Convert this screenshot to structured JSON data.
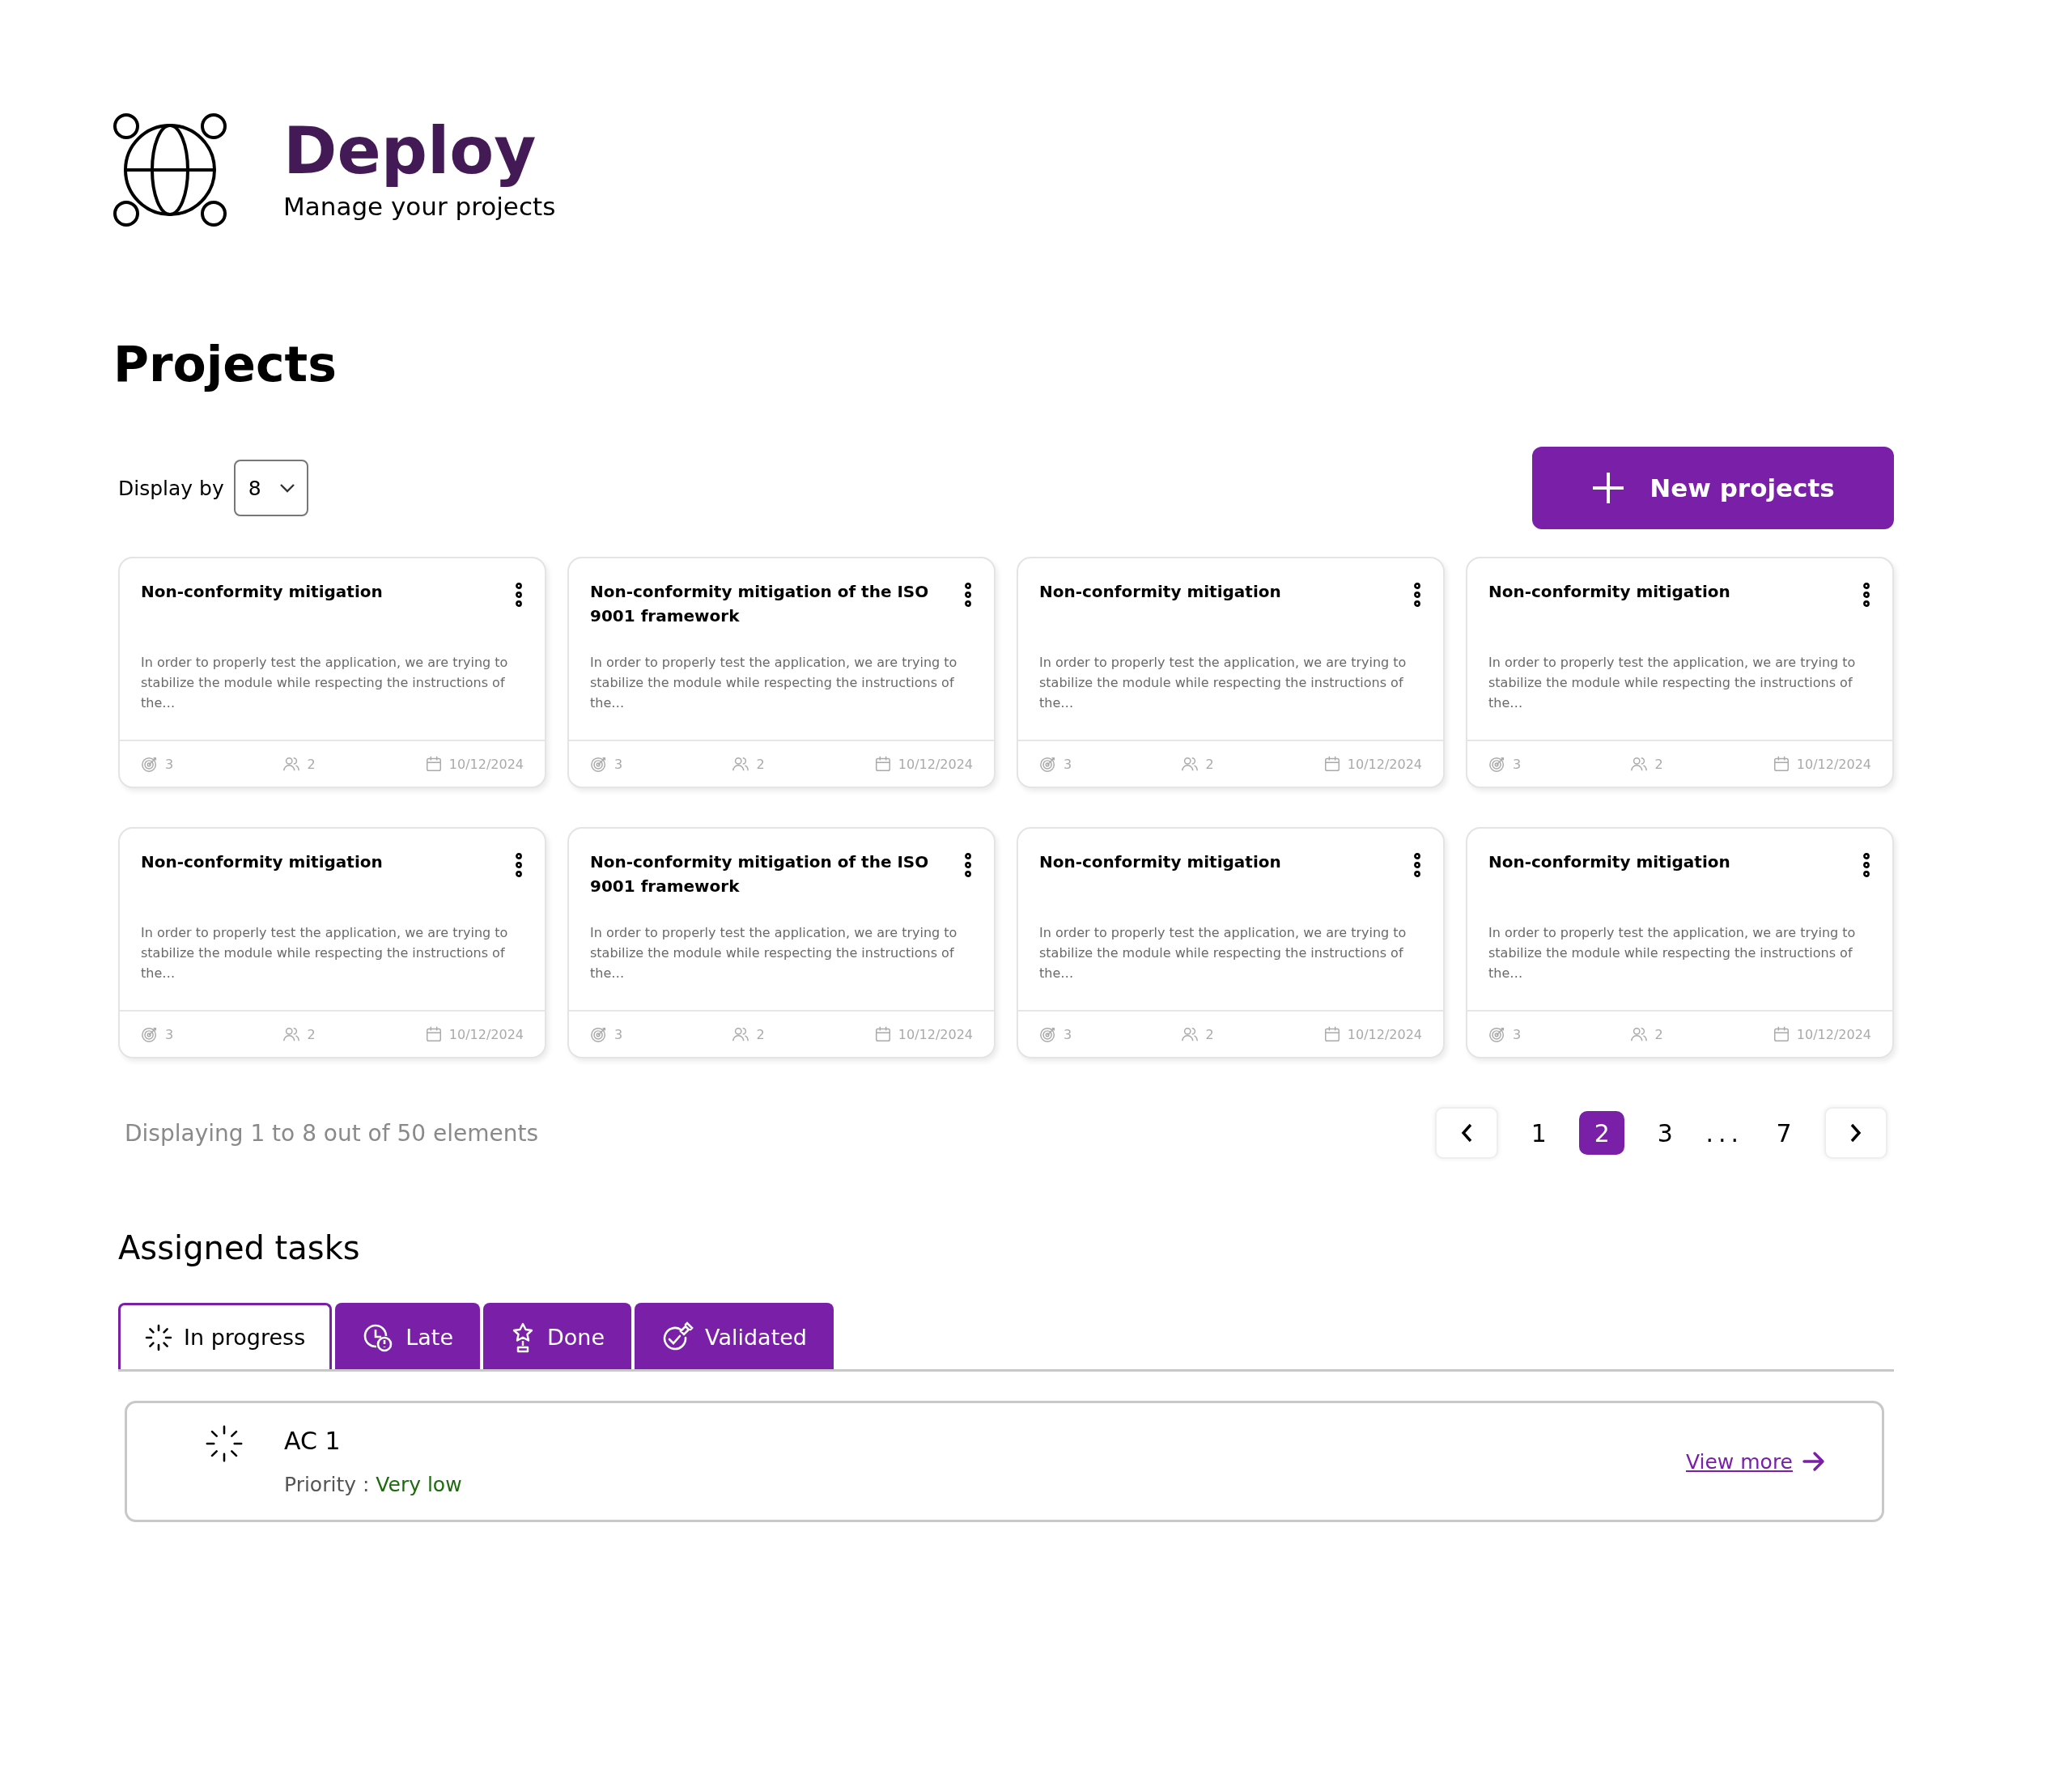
{
  "header": {
    "title": "Deploy",
    "subtitle": "Manage your projects"
  },
  "projects": {
    "heading": "Projects",
    "display_by": {
      "label": "Display by",
      "value": "8"
    },
    "new_button": "New projects",
    "cards": [
      {
        "title": "Non-conformity mitigation",
        "description": "In order to properly test the application, we are trying to stabilize the module while respecting the instructions of the…",
        "objectives": "3",
        "members": "2",
        "date": "10/12/2024"
      },
      {
        "title": "Non-conformity mitigation of the ISO 9001 framework",
        "description": "In order to properly test the application, we are trying to stabilize the module while respecting the instructions of the…",
        "objectives": "3",
        "members": "2",
        "date": "10/12/2024"
      },
      {
        "title": "Non-conformity mitigation",
        "description": "In order to properly test the application, we are trying to stabilize the module while respecting the instructions of the…",
        "objectives": "3",
        "members": "2",
        "date": "10/12/2024"
      },
      {
        "title": "Non-conformity mitigation",
        "description": "In order to properly test the application, we are trying to stabilize the module while respecting the instructions of the…",
        "objectives": "3",
        "members": "2",
        "date": "10/12/2024"
      },
      {
        "title": "Non-conformity mitigation",
        "description": "In order to properly test the application, we are trying to stabilize the module while respecting the instructions of the…",
        "objectives": "3",
        "members": "2",
        "date": "10/12/2024"
      },
      {
        "title": "Non-conformity mitigation of the ISO 9001 framework",
        "description": "In order to properly test the application, we are trying to stabilize the module while respecting the instructions of the…",
        "objectives": "3",
        "members": "2",
        "date": "10/12/2024"
      },
      {
        "title": "Non-conformity mitigation",
        "description": "In order to properly test the application, we are trying to stabilize the module while respecting the instructions of the…",
        "objectives": "3",
        "members": "2",
        "date": "10/12/2024"
      },
      {
        "title": "Non-conformity mitigation",
        "description": "In order to properly test the application, we are trying to stabilize the module while respecting the instructions of the…",
        "objectives": "3",
        "members": "2",
        "date": "10/12/2024"
      }
    ],
    "summary": "Displaying 1 to 8 out of 50 elements",
    "pagination": [
      {
        "kind": "page",
        "label": "1",
        "selected": false
      },
      {
        "kind": "page",
        "label": "2",
        "selected": true
      },
      {
        "kind": "page",
        "label": "3",
        "selected": false
      },
      {
        "kind": "ellipsis",
        "label": "..."
      },
      {
        "kind": "page",
        "label": "7",
        "selected": false
      }
    ]
  },
  "assigned_tasks": {
    "heading": "Assigned tasks",
    "tabs": [
      {
        "kind": "spinner",
        "label": "In progress",
        "selected": true
      },
      {
        "kind": "clock",
        "label": "Late",
        "selected": false
      },
      {
        "kind": "trophy",
        "label": "Done",
        "selected": false
      },
      {
        "kind": "validated",
        "label": "Validated",
        "selected": false
      }
    ],
    "tasks": [
      {
        "name": "AC 1",
        "priority_label": "Priority :",
        "priority": "Very low",
        "link": "View more"
      }
    ]
  }
}
